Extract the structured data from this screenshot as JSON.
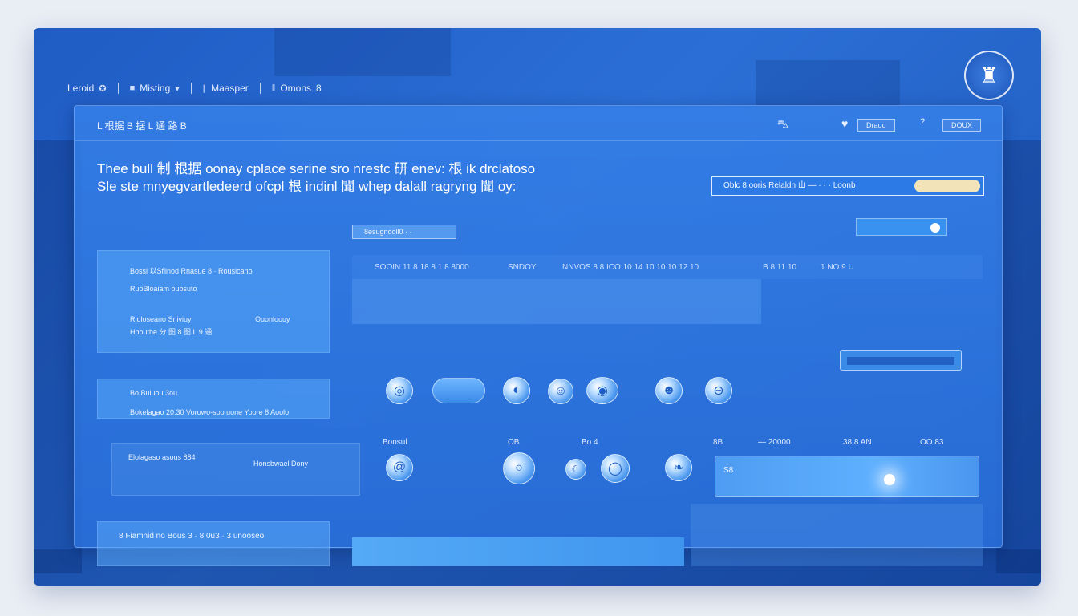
{
  "topnav": {
    "items": [
      {
        "label": "Leroid",
        "icon": "brand-icon"
      },
      {
        "label": "Misting",
        "icon": "square-icon",
        "chevron": "▾"
      },
      {
        "label": "Maasper",
        "icon": "bracket-icon"
      },
      {
        "label": "Omons",
        "icon": "bar-icon",
        "suffix": "8"
      }
    ]
  },
  "badge": {
    "icon": "emblem-icon",
    "glyph": "♜"
  },
  "panel": {
    "breadcrumb": "L 根据 B 据 L 通 路 B",
    "header": {
      "car_icon": "⛍",
      "heart_icon": "♥",
      "btn1_label": "Drauo",
      "help_icon": "?",
      "btn2_label": "DOUX"
    },
    "headline_line1": "Thee bull 制 根据 oonay cplace serine sro nrestc 研 enev: 根 ik drclatoso",
    "headline_line2": "Sle ste mnyegvartledeerd ofcpl 根 indinl 聞 whep dalall ragryng 聞 oy:",
    "search": {
      "label": "Oblc 8 ooris Relaldn 山 — · · · Loonb"
    },
    "toggle": {
      "state": "on"
    }
  },
  "left_cards": [
    {
      "title": "Bossi 以Sfllnod Rnasue 8 · Rousicano",
      "sub": "RuoBloaiam oubsuto"
    },
    {
      "title": "Rioloseano Sniviuy",
      "sub": "Hhouthe 分 图 8 图 L 9 通",
      "right": "Ouonloouy"
    },
    {
      "title": "Bo Buiuou 3ou",
      "sub": "Bokelagao 20:30 Vorowo-soo uone Yoore 8 Aoolo"
    },
    {
      "title": "Elolagaso asous 884",
      "sub": "Honsbwael Dony"
    }
  ],
  "filter_chip": "8esugnooll0 · ·",
  "table_header": [
    "SOOIN 11 8 18 8 1 8 8000",
    "SNDOY",
    "NNVOS 8 8 ICO 10 14 10 10 10 12 10",
    "B 8 11 10",
    "1 NO 9 U"
  ],
  "icon_buttons": [
    "globe-icon",
    "toggle-icon",
    "chat-icon",
    "cloud-icon",
    "mic-icon",
    "face-icon",
    "link-icon"
  ],
  "row_labels": [
    "Bonsul",
    "OB",
    "Bo 4",
    "8B",
    "— 20000",
    "38 8 AN",
    "OO 83"
  ],
  "row_icons": [
    "at-icon",
    "ring-icon",
    "moon-icon",
    "circle-icon",
    "leaf-icon"
  ],
  "blob_label": "S8",
  "footer": {
    "left_label": "8 Fiamnid no Bous 3 · 8 0u3 · 3 unooseo"
  }
}
